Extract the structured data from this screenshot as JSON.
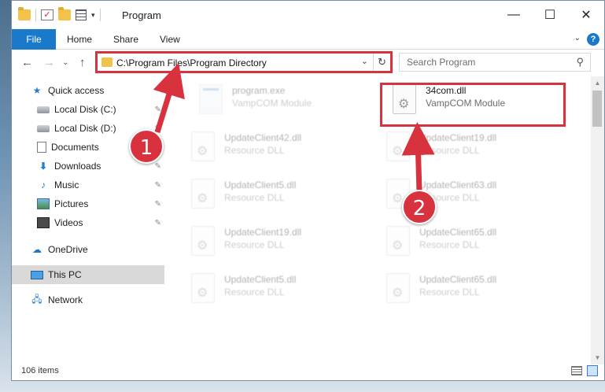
{
  "window": {
    "title": "Program"
  },
  "title_controls": {
    "minimize": "—",
    "maximize": "☐",
    "close": "✕"
  },
  "ribbon": {
    "tabs": [
      {
        "label": "File"
      },
      {
        "label": "Home"
      },
      {
        "label": "Share"
      },
      {
        "label": "View"
      }
    ],
    "help": "?",
    "expand": "⌄"
  },
  "nav": {
    "back": "←",
    "forward": "→",
    "recent": "⌄",
    "up": "↑",
    "address": "C:\\Program Files\\Program Directory",
    "address_dropdown": "⌄",
    "refresh": "↻",
    "search_placeholder": "Search Program",
    "search_icon": "⚲"
  },
  "sidebar": {
    "items": [
      {
        "label": "Quick access",
        "icon": "star-icon"
      },
      {
        "label": "Local Disk (C:)",
        "icon": "disk-icon",
        "pin": "✎"
      },
      {
        "label": "Local Disk (D:)",
        "icon": "disk-icon",
        "pin": "✎"
      },
      {
        "label": "Documents",
        "icon": "document-icon",
        "pin": "✎"
      },
      {
        "label": "Downloads",
        "icon": "download-icon",
        "pin": "✎"
      },
      {
        "label": "Music",
        "icon": "music-icon",
        "pin": "✎"
      },
      {
        "label": "Pictures",
        "icon": "pictures-icon",
        "pin": "✎"
      },
      {
        "label": "Videos",
        "icon": "videos-icon",
        "pin": "✎"
      },
      {
        "label": "OneDrive",
        "icon": "cloud-icon"
      },
      {
        "label": "This PC",
        "icon": "pc-icon"
      },
      {
        "label": "Network",
        "icon": "network-icon"
      }
    ]
  },
  "files": {
    "exe": {
      "name": "program.exe",
      "desc": "VampCOM Module"
    },
    "target": {
      "name": "34com.dll",
      "desc": "VampCOM Module"
    },
    "items": [
      {
        "name": "UpdateClient42.dll",
        "desc": "Resource DLL"
      },
      {
        "name": "UpdateClient19.dll",
        "desc": "Resource DLL"
      },
      {
        "name": "UpdateClient5.dll",
        "desc": "Resource DLL"
      },
      {
        "name": "UpdateClient63.dll",
        "desc": "Resource DLL"
      },
      {
        "name": "UpdateClient19.dll",
        "desc": "Resource DLL"
      },
      {
        "name": "UpdateClient65.dll",
        "desc": "Resource DLL"
      },
      {
        "name": "UpdateClient5.dll",
        "desc": "Resource DLL"
      },
      {
        "name": "UpdateClient65.dll",
        "desc": "Resource DLL"
      }
    ]
  },
  "status": {
    "count": "106 items"
  },
  "annotations": {
    "step1": "1",
    "step2": "2"
  },
  "colors": {
    "accent": "#1979ca",
    "highlight": "#d8323e"
  }
}
